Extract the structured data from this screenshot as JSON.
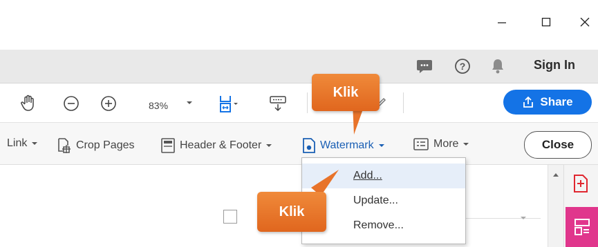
{
  "window": {
    "minimize_icon": "minimize-icon",
    "maximize_icon": "maximize-icon",
    "close_icon": "close-icon"
  },
  "header": {
    "icons": [
      "comment-icon",
      "help-icon",
      "bell-icon"
    ],
    "sign_in": "Sign In"
  },
  "toolbar": {
    "icons": [
      "hand-icon",
      "zoom-out-icon",
      "zoom-in-icon",
      "fit-page-icon",
      "keyboard-icon",
      "pen-icon"
    ],
    "zoom_value": "83%",
    "share_label": "Share"
  },
  "tools": {
    "link_label": "Link",
    "crop_label": "Crop Pages",
    "header_footer_label": "Header & Footer",
    "watermark_label": "Watermark",
    "more_label": "More",
    "close_label": "Close"
  },
  "watermark_menu": {
    "items": [
      "Add...",
      "Update...",
      "Remove..."
    ],
    "highlighted": "Add..."
  },
  "callouts": {
    "top": "Klik",
    "bottom": "Klik"
  },
  "colors": {
    "accent": "#1473e6",
    "callout": "#e8732a",
    "right_panel_pink": "#e0368c",
    "right_panel_red": "#e0262f"
  }
}
